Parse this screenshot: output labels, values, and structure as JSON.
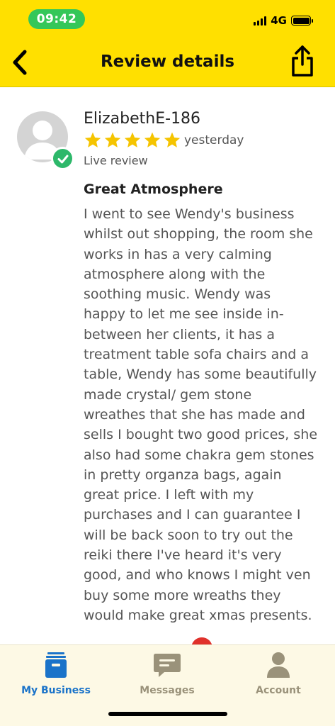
{
  "status_bar": {
    "time": "09:42",
    "network": "4G",
    "icons": [
      "signal-icon",
      "battery-icon"
    ]
  },
  "header": {
    "title": "Review details",
    "back_icon": "chevron-left-icon",
    "share_icon": "share-icon"
  },
  "colors": {
    "header_bg": "#ffe000",
    "star": "#f5c400",
    "verified": "#2db86a",
    "active_tab": "#1a73c9",
    "inactive_tab": "#9a927a"
  },
  "review": {
    "reviewer": "ElizabethE-186",
    "rating": 5,
    "max_rating": 5,
    "date": "yesterday",
    "status": "Live review",
    "title": "Great Atmosphere",
    "body_lines": [
      "I went to see Wendy's business",
      "whilst out shopping, the room she",
      "works in has a very calming",
      "atmosphere along with the",
      "soothing music. Wendy was",
      "happy to let me see inside in-",
      "between her clients, it has a",
      "treatment table sofa chairs and a",
      "table, Wendy has some beautifully",
      "made crystal/ gem stone",
      "wreathes that she has made and",
      "sells I bought two good prices, she",
      "also had some chakra gem stones",
      "in pretty organza bags, again",
      "great price. I left with my",
      "purchases and I can guarantee I",
      "will be back soon to try out the",
      "reiki there I've heard it's very",
      "good, and who knows I might ven",
      "buy some more wreaths they",
      "would make great xmas presents."
    ]
  },
  "tabs": [
    {
      "label": "My Business",
      "icon": "archive-box-icon",
      "active": true
    },
    {
      "label": "Messages",
      "icon": "message-icon",
      "active": false
    },
    {
      "label": "Account",
      "icon": "person-icon",
      "active": false
    }
  ]
}
